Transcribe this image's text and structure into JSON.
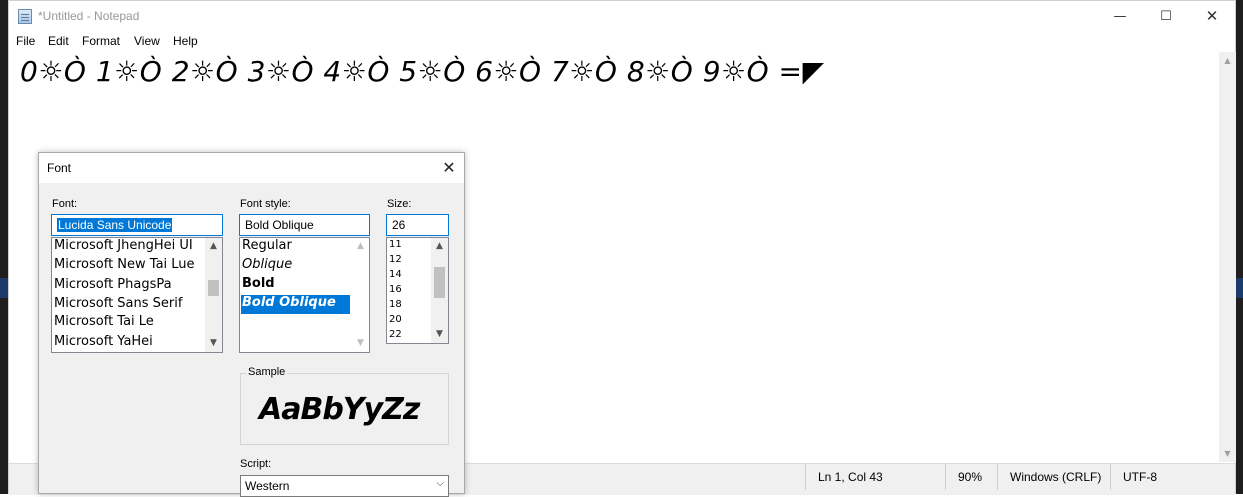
{
  "window": {
    "title": "*Untitled - Notepad",
    "minimize_glyph": "—",
    "maximize_glyph": "☐",
    "close_glyph": "✕"
  },
  "menu": [
    "File",
    "Edit",
    "Format",
    "View",
    "Help"
  ],
  "editor": {
    "content": "0☼Ò 1☼Ò 2☼Ò 3☼Ò 4☼Ò 5☼Ò 6☼Ò 7☼Ò 8☼Ò 9☼Ò =◤"
  },
  "status": {
    "position": "Ln 1, Col 43",
    "zoom": "90%",
    "line_ending": "Windows (CRLF)",
    "encoding": "UTF-8"
  },
  "font_dialog": {
    "title": "Font",
    "close_glyph": "✕",
    "font_label": "Font:",
    "font_value": "Lucida Sans Unicode",
    "font_list": [
      "Microsoft JhengHei UI",
      "Microsoft New Tai Lue",
      "Microsoft PhagsPa",
      "Microsoft Sans Serif",
      "Microsoft Tai Le",
      "Microsoft YaHei"
    ],
    "style_label": "Font style:",
    "style_value": "Bold Oblique",
    "style_list": [
      "Regular",
      "Oblique",
      "Bold",
      "Bold Oblique"
    ],
    "size_label": "Size:",
    "size_value": "26",
    "size_list": [
      "11",
      "12",
      "14",
      "16",
      "18",
      "20",
      "22"
    ],
    "sample_label": "Sample",
    "sample_text": "AaBbYyZz",
    "script_label": "Script:",
    "script_value": "Western"
  },
  "colors": {
    "accent": "#0078d7",
    "dialog_bg": "#f0f0f0"
  }
}
